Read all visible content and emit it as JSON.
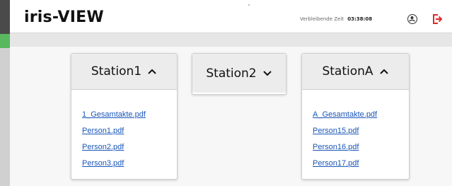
{
  "app": {
    "title": "iris-VIEW"
  },
  "header": {
    "time_label": "Verbleibende Zeit",
    "time_value": "03:38:08"
  },
  "stations": [
    {
      "label": "Station1",
      "expanded": true,
      "files": [
        "1_Gesamtakte.pdf",
        "Person1.pdf",
        "Person2.pdf",
        "Person3.pdf"
      ]
    },
    {
      "label": "Station2",
      "expanded": false,
      "files": []
    },
    {
      "label": "StationA",
      "expanded": true,
      "files": [
        "A_Gesamtakte.pdf",
        "Person15.pdf",
        "Person16.pdf",
        "Person17.pdf"
      ]
    }
  ],
  "icons": {
    "user": "user-circle-icon",
    "logout": "logout-icon",
    "expanded": "chevron-up-icon",
    "collapsed": "chevron-down-icon"
  },
  "colors": {
    "link": "#1a56b8",
    "logout": "#e02a2a",
    "accent_green": "#59b85d"
  }
}
